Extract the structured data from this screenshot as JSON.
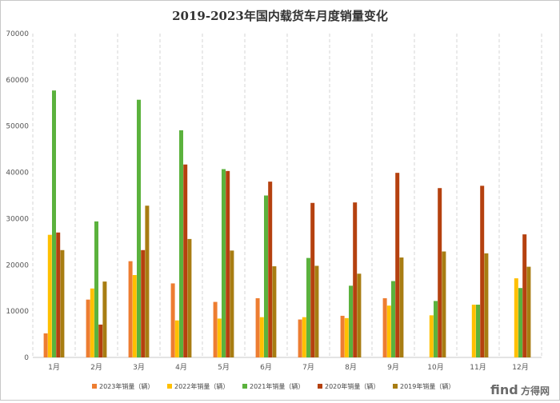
{
  "chart_data": {
    "type": "bar",
    "title": "2019-2023年国内载货车月度销量变化",
    "categories": [
      "1月",
      "2月",
      "3月",
      "4月",
      "5月",
      "6月",
      "7月",
      "8月",
      "9月",
      "10月",
      "11月",
      "12月"
    ],
    "ylim": [
      0,
      70000
    ],
    "yticks": [
      0,
      10000,
      20000,
      30000,
      40000,
      50000,
      60000,
      70000
    ],
    "grid": "vertical-dashed",
    "legend_position": "bottom",
    "series": [
      {
        "name": "2023年销量（辆）",
        "color": "#ED7D31",
        "values": [
          5200,
          12500,
          20800,
          16000,
          12000,
          12800,
          8200,
          9000,
          12800,
          null,
          null,
          null
        ]
      },
      {
        "name": "2022年销量（辆）",
        "color": "#FFC000",
        "values": [
          26500,
          14900,
          17800,
          8000,
          8400,
          8700,
          8700,
          8500,
          11200,
          9100,
          11400,
          17100
        ]
      },
      {
        "name": "2021年销量（辆）",
        "color": "#5BB23D",
        "values": [
          57700,
          29400,
          55700,
          49100,
          40700,
          35000,
          21500,
          15500,
          16500,
          12200,
          11400,
          15000
        ]
      },
      {
        "name": "2020年销量（辆）",
        "color": "#B5410F",
        "values": [
          27000,
          7100,
          23200,
          41700,
          40300,
          38000,
          33400,
          33500,
          39900,
          36600,
          37100,
          26600
        ]
      },
      {
        "name": "2019年销量（辆）",
        "color": "#A87D12",
        "values": [
          23200,
          16400,
          32800,
          25600,
          23100,
          19700,
          19800,
          18100,
          21600,
          22900,
          22500,
          19600
        ]
      }
    ]
  },
  "watermark": {
    "brand": "find",
    "suffix": "方得网"
  }
}
